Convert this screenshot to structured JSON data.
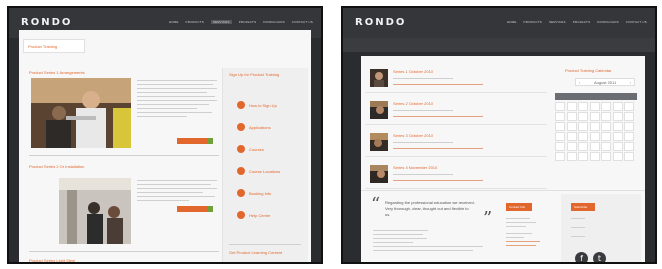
{
  "left": {
    "logo": "RONDO",
    "menu": [
      "HOME",
      "PRODUCTS",
      "SERVICES",
      "PROJECTS",
      "DOWNLOADS",
      "CONTACT US"
    ],
    "tab_label": "Product Training",
    "section1_title": "Product Series 1 Arrangements",
    "section2_title": "Product Series 2 Or Installation",
    "section3_title": "Product Series Light Steel",
    "sidebar_title": "Sign Up for Product Training",
    "sidebar_links": [
      "How to Sign Up",
      "Applications",
      "Courses",
      "Course Locations",
      "Booking Info",
      "Help Centre"
    ],
    "sidebar_bottom": "Get Product Learning Content"
  },
  "right": {
    "logo": "RONDO",
    "menu": [
      "HOME",
      "PRODUCTS",
      "SERVICES",
      "PROJECTS",
      "DOWNLOADS",
      "CONTACT US"
    ],
    "events": [
      {
        "title": "Series 1 October 2010"
      },
      {
        "title": "Series 2 October 2010"
      },
      {
        "title": "Series 3 October 2010"
      },
      {
        "title": "Series 4 November 2010"
      }
    ],
    "calendar_title": "Product Training Calendar",
    "calendar_month": "August 2011",
    "quote_open": "“",
    "quote_close": "”",
    "quote_text": "Regarding the professional education we received. Very thorough, clear, thought out and flexible to us.",
    "contact_label": "Contact Info",
    "side_label": "Subscribe",
    "social": [
      "f",
      "t"
    ]
  },
  "colors": {
    "accent": "#e2672c",
    "dark": "#2b2c2f",
    "green": "#70a03c"
  }
}
